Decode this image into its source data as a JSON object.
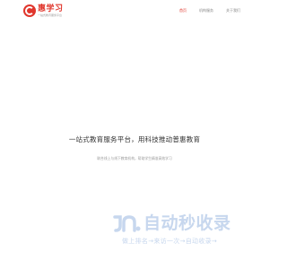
{
  "header": {
    "logo_title": "惠学习",
    "logo_subtitle": "一站式教育服务平台",
    "nav": [
      {
        "label": "首页",
        "active": true
      },
      {
        "label": "机构服务",
        "active": false
      },
      {
        "label": "关于我们",
        "active": false
      }
    ]
  },
  "hero": {
    "title": "一站式教育服务平台，用科技推动普惠教育",
    "subtitle": "联合线上与线下教育机构，帮助学生精准高效学习"
  },
  "watermark": {
    "title": "自动秒收录",
    "tagline": "做上排名→来访一次→自动收录→"
  },
  "colors": {
    "accent": "#e0362c",
    "watermark": "#c7d7ee",
    "text": "#333333",
    "muted": "#9a9a9a"
  }
}
